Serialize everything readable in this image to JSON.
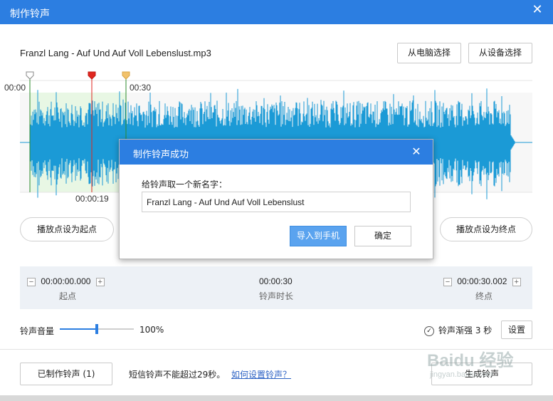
{
  "window": {
    "title": "制作铃声",
    "close_glyph": "✕"
  },
  "file": {
    "name": "Franzl Lang - Auf Und Auf Voll Lebenslust.mp3"
  },
  "source_buttons": {
    "from_pc": "从电脑选择",
    "from_device": "从设备选择"
  },
  "timeline": {
    "marker_start_time": "00:00",
    "marker_end_time": "00:30",
    "playhead_time": "00:00:19"
  },
  "controls": {
    "set_start_label": "播放点设为起点",
    "set_end_label": "播放点设为终点"
  },
  "times": {
    "start_value": "00:00:00.000",
    "start_label": "起点",
    "duration_value": "00:00:30",
    "duration_label": "铃声时长",
    "end_value": "00:00:30.002",
    "end_label": "终点",
    "minus_glyph": "−",
    "plus_glyph": "+"
  },
  "volume": {
    "label": "铃声音量",
    "value_text": "100%",
    "level": 0.5
  },
  "fade": {
    "label": "铃声渐强 3 秒",
    "checked": true,
    "check_glyph": "✓"
  },
  "settings_label": "设置",
  "footer": {
    "made_button": "已制作铃声 (1)",
    "hint": "短信铃声不能超过29秒。",
    "help_link": "如何设置铃声？",
    "generate_button": "生成铃声"
  },
  "watermark": {
    "text": "Baidu 经验",
    "subtext": "jingyan.baidu.com"
  },
  "dialog": {
    "title": "制作铃声成功",
    "close_glyph": "✕",
    "prompt": "给铃声取一个新名字：",
    "name_value": "Franzl Lang - Auf Und Auf Voll Lebenslust",
    "import_button": "导入到手机",
    "ok_button": "确定"
  },
  "colors": {
    "accent": "#2c7ee1",
    "waveform": "#1b9ad6",
    "selection": "#e8f7e4",
    "start_marker": "#c7c7c7",
    "playhead": "#e0261f",
    "end_marker": "#f2c26b"
  }
}
